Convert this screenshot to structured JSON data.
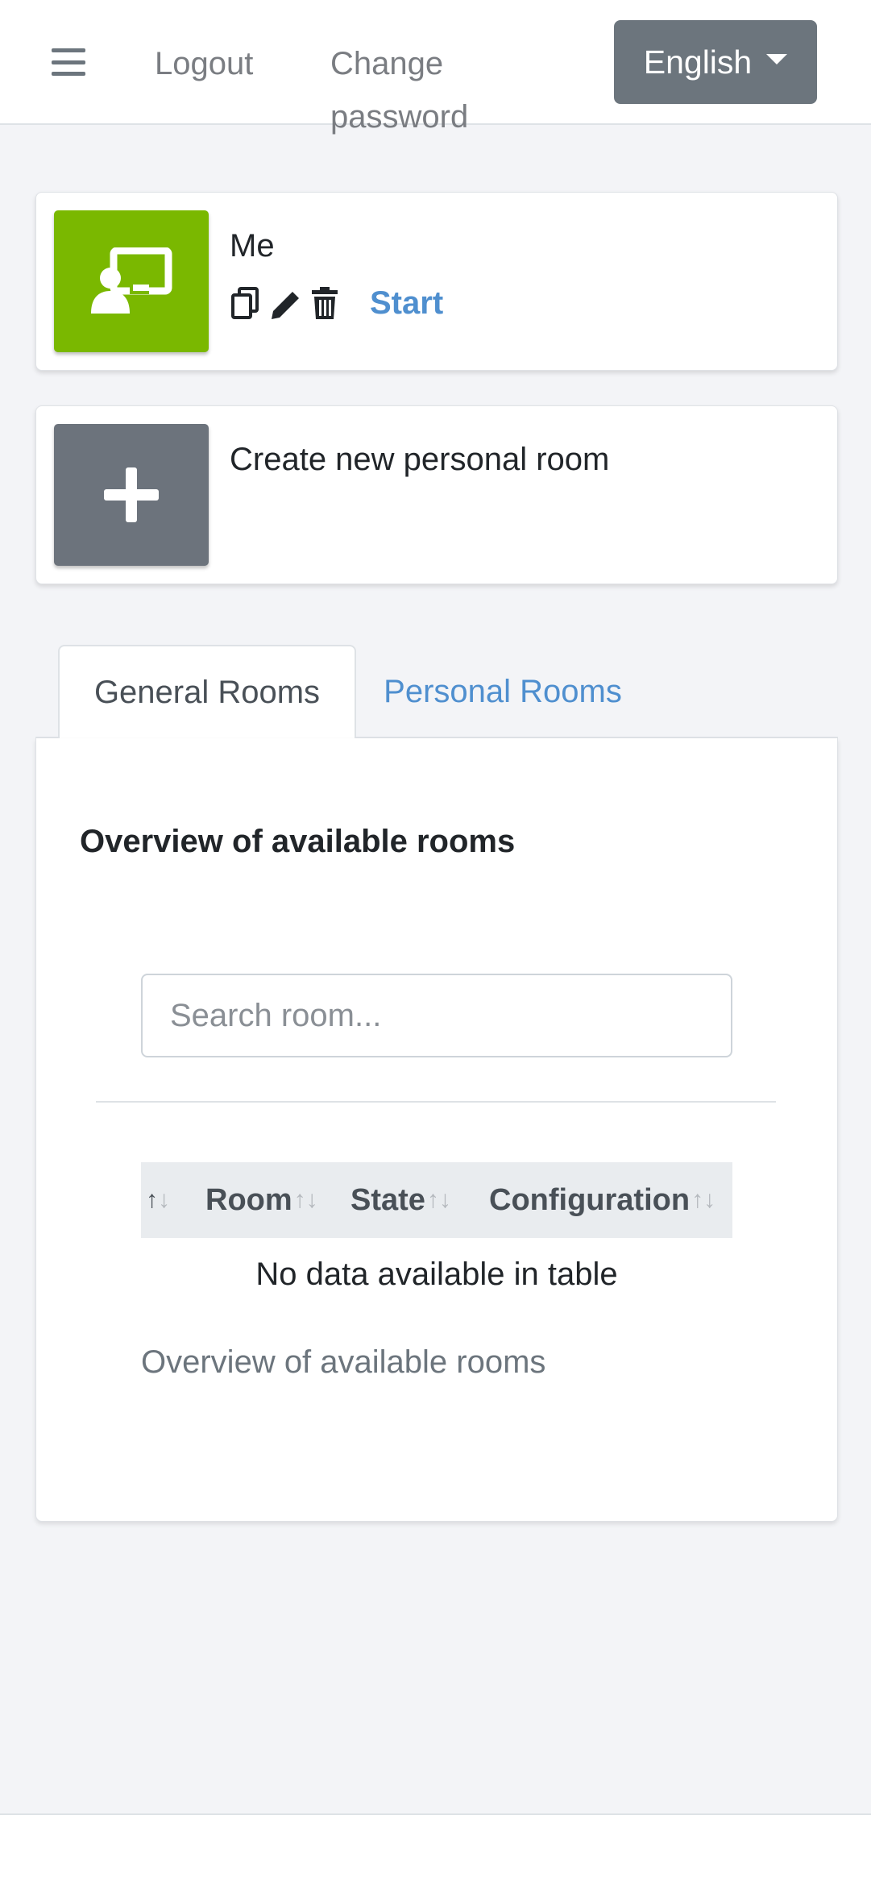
{
  "navbar": {
    "menu_icon": "hamburger-menu-icon",
    "logout": "Logout",
    "change_password": "Change password",
    "language": "English"
  },
  "rooms": [
    {
      "name": "Me",
      "tile_color": "#7ab800",
      "icon": "presentation-user-icon",
      "actions": [
        "copy-icon",
        "edit-pencil-icon",
        "trash-icon"
      ],
      "start_label": "Start"
    }
  ],
  "create_room": {
    "label": "Create new personal room",
    "icon": "plus-icon",
    "tile_color": "#6c737c"
  },
  "tabs": [
    {
      "label": "General Rooms",
      "active": true
    },
    {
      "label": "Personal Rooms",
      "active": false
    }
  ],
  "panel": {
    "title": "Overview of available rooms",
    "search_placeholder": "Search room...",
    "table": {
      "columns": [
        "",
        "Room",
        "State",
        "Configuration"
      ],
      "empty_message": "No data available in table",
      "caption": "Overview of available rooms"
    }
  },
  "colors": {
    "accent_link": "#4f8fcf",
    "secondary_button": "#6c757d",
    "page_background": "#f3f4f7"
  }
}
